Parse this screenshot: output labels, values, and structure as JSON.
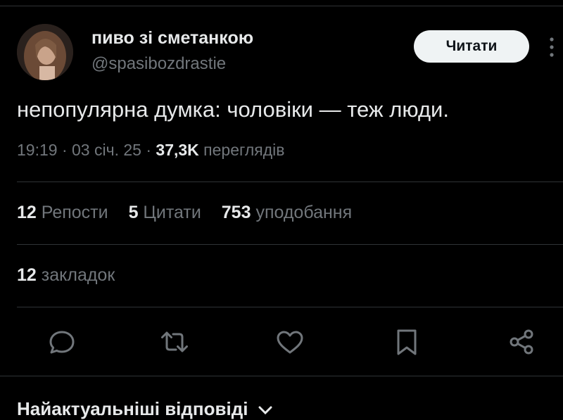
{
  "author": {
    "display_name": "пиво зі сметанкою",
    "handle": "@spasibozdrastie"
  },
  "follow_button": {
    "label": "Читати"
  },
  "tweet": {
    "text": "непопулярна думка: чоловіки — теж люди.",
    "time": "19:19",
    "date": "03 січ. 25",
    "views_count": "37,3K",
    "views_label": "переглядів"
  },
  "stats": {
    "reposts_count": "12",
    "reposts_label": "Репости",
    "quotes_count": "5",
    "quotes_label": "Цитати",
    "likes_count": "753",
    "likes_label": "уподобання",
    "bookmarks_count": "12",
    "bookmarks_label": "закладок"
  },
  "actions": {
    "icons": [
      "reply-icon",
      "repost-icon",
      "like-icon",
      "bookmark-icon",
      "share-icon"
    ]
  },
  "replies": {
    "title": "Найактуальніші відповіді"
  },
  "colors": {
    "background": "#000000",
    "primary_text": "#e7e9ea",
    "secondary_text": "#71767b",
    "divider": "#2f3336",
    "button_bg": "#eff3f4"
  }
}
